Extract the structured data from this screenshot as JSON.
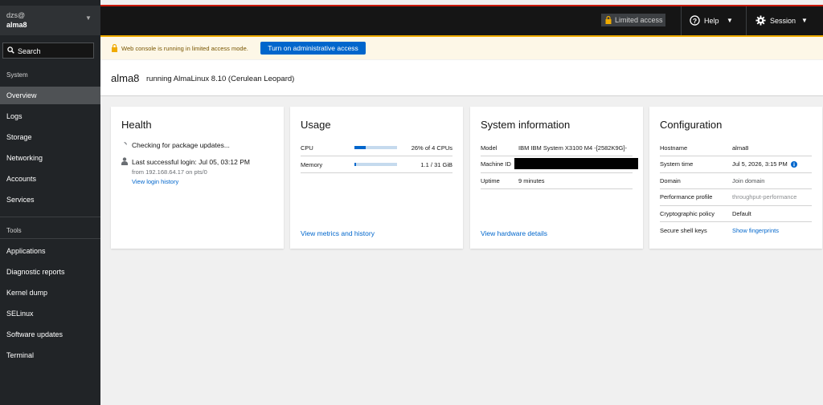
{
  "host_switcher": {
    "user": "dzs@",
    "host": "alma8"
  },
  "search": {
    "label": "Search"
  },
  "nav": {
    "system_header": "System",
    "system_items": [
      "Overview",
      "Logs",
      "Storage",
      "Networking",
      "Accounts",
      "Services"
    ],
    "tools_header": "Tools",
    "tools_items": [
      "Applications",
      "Diagnostic reports",
      "Kernel dump",
      "SELinux",
      "Software updates",
      "Terminal"
    ],
    "active": "Overview"
  },
  "masthead": {
    "limited_access": "Limited access",
    "help": "Help",
    "session": "Session"
  },
  "banner": {
    "text": "Web console is running in limited access mode.",
    "button": "Turn on administrative access"
  },
  "page": {
    "host": "alma8",
    "os": "running AlmaLinux 8.10 (Cerulean Leopard)"
  },
  "health": {
    "title": "Health",
    "checking": "Checking for package updates...",
    "last_login": "Last successful login: Jul 05, 03:12 PM",
    "login_from": "from 192.168.64.17 on pts/0",
    "login_link": "View login history"
  },
  "usage": {
    "title": "Usage",
    "cpu_label": "CPU",
    "cpu_value": "26% of 4 CPUs",
    "cpu_fraction": 0.26,
    "memory_label": "Memory",
    "memory_value": "1.1 / 31 GiB",
    "memory_fraction": 0.035,
    "link": "View metrics and history"
  },
  "system_info": {
    "title": "System information",
    "model_label": "Model",
    "model_value": "IBM IBM System X3100 M4 -[2582K9G]-",
    "machine_id_label": "Machine ID",
    "uptime_label": "Uptime",
    "uptime_value": "9 minutes",
    "link": "View hardware details"
  },
  "configuration": {
    "title": "Configuration",
    "rows": [
      {
        "label": "Hostname",
        "value": "alma8"
      },
      {
        "label": "System time",
        "value": "Jul 5, 2026, 3:15 PM"
      },
      {
        "label": "Domain",
        "value": "Join domain"
      },
      {
        "label": "Performance profile",
        "value": "throughput-performance"
      },
      {
        "label": "Cryptographic policy",
        "value": "Default"
      },
      {
        "label": "Secure shell keys",
        "value": "Show fingerprints"
      }
    ]
  },
  "colors": {
    "accent": "#0066cc",
    "sidebar_bg": "#212427",
    "masthead_bg": "#151515",
    "warning": "#f0ab00",
    "top_accent": "#c9190b"
  }
}
